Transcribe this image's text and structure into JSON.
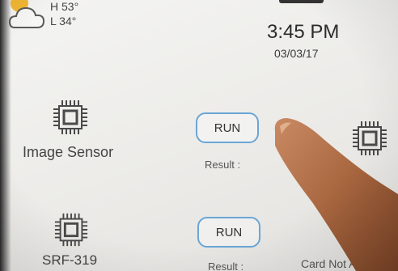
{
  "weather": {
    "high": "H 53°",
    "low": "L 34°",
    "icon": "partly-cloudy-icon"
  },
  "clock": {
    "time": "3:45 PM",
    "date": "03/03/17"
  },
  "rows": [
    {
      "name": "Image Sensor",
      "run_label": "RUN",
      "result_label": "Result :"
    },
    {
      "name": "SRF-319",
      "run_label": "RUN",
      "result_label": "Result :",
      "status": "Card Not A"
    }
  ],
  "icons": [
    "chip-icon"
  ]
}
